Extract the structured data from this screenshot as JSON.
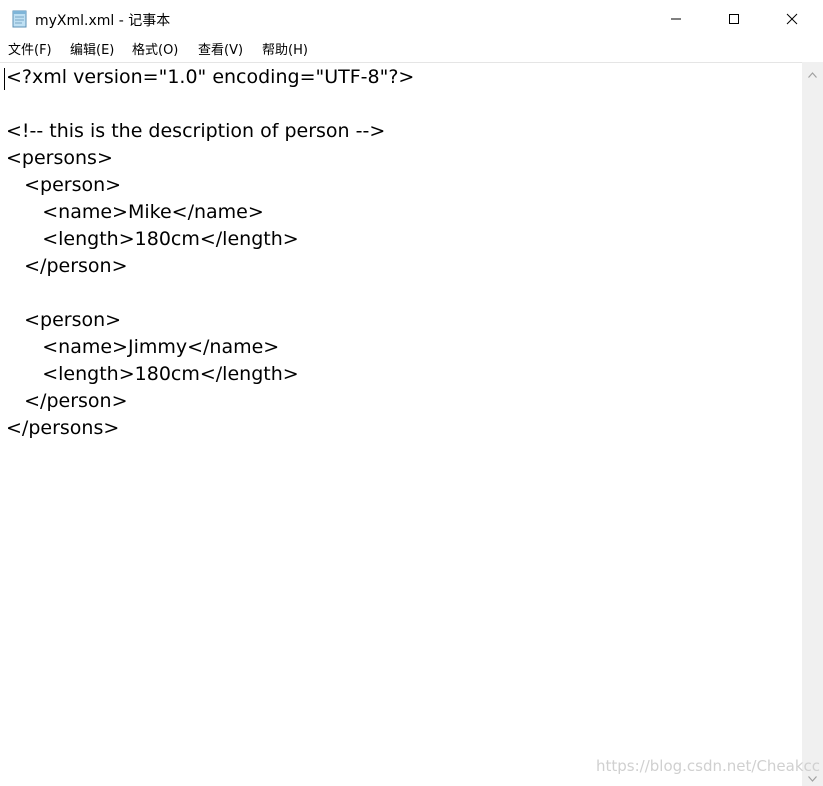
{
  "window": {
    "title": "myXml.xml - 记事本",
    "app_icon": "notepad-icon",
    "controls": {
      "minimize_icon": "minimize-icon",
      "maximize_icon": "maximize-icon",
      "close_icon": "close-icon"
    }
  },
  "menubar": {
    "items": [
      {
        "label": "文件(F)"
      },
      {
        "label": "编辑(E)"
      },
      {
        "label": "格式(O)"
      },
      {
        "label": "查看(V)"
      },
      {
        "label": "帮助(H)"
      }
    ]
  },
  "editor": {
    "lines": [
      "<?xml version=\"1.0\" encoding=\"UTF-8\"?>",
      "",
      "<!-- this is the description of person -->",
      "<persons>",
      "   <person>",
      "      <name>Mike</name>",
      "      <length>180cm</length>",
      "   </person>",
      "",
      "   <person>",
      "      <name>Jimmy</name>",
      "      <length>180cm</length>",
      "   </person>",
      "</persons>"
    ]
  },
  "scrollbar": {
    "up_icon": "scroll-up-arrow-icon",
    "down_icon": "scroll-down-arrow-icon"
  },
  "watermark": "https://blog.csdn.net/Cheakcc"
}
